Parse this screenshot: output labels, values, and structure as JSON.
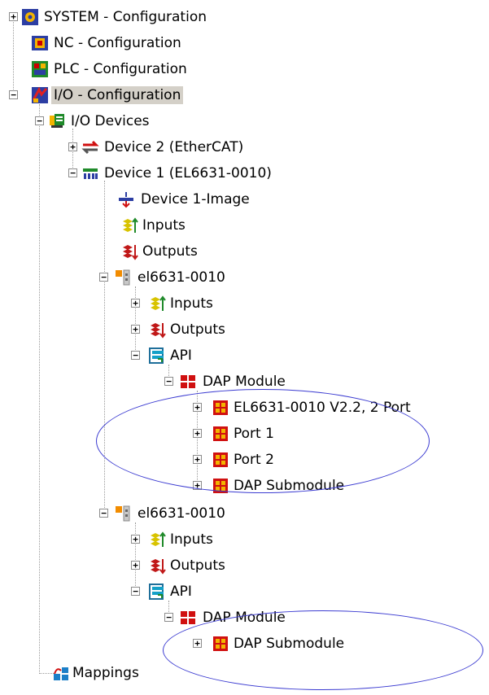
{
  "tree": {
    "system": "SYSTEM - Configuration",
    "nc": "NC - Configuration",
    "plc": "PLC - Configuration",
    "io": "I/O - Configuration",
    "io_devices": "I/O Devices",
    "device2": "Device 2 (EtherCAT)",
    "device1": "Device 1 (EL6631-0010)",
    "device1_image": "Device 1-Image",
    "device1_inputs": "Inputs",
    "device1_outputs": "Outputs",
    "box1": {
      "label": "el6631-0010",
      "inputs": "Inputs",
      "outputs": "Outputs",
      "api": "API",
      "dap_module": "DAP Module",
      "items": [
        "EL6631-0010 V2.2, 2 Port",
        "Port 1",
        "Port 2",
        "DAP Submodule"
      ]
    },
    "box2": {
      "label": "el6631-0010",
      "inputs": "Inputs",
      "outputs": "Outputs",
      "api": "API",
      "dap_module": "DAP Module",
      "items": [
        "DAP Submodule"
      ]
    },
    "mappings": "Mappings"
  },
  "colors": {
    "selection": "#d4d0c8",
    "ellipse": "#3b3bd1",
    "tree_lines": "#9a9a9a"
  }
}
